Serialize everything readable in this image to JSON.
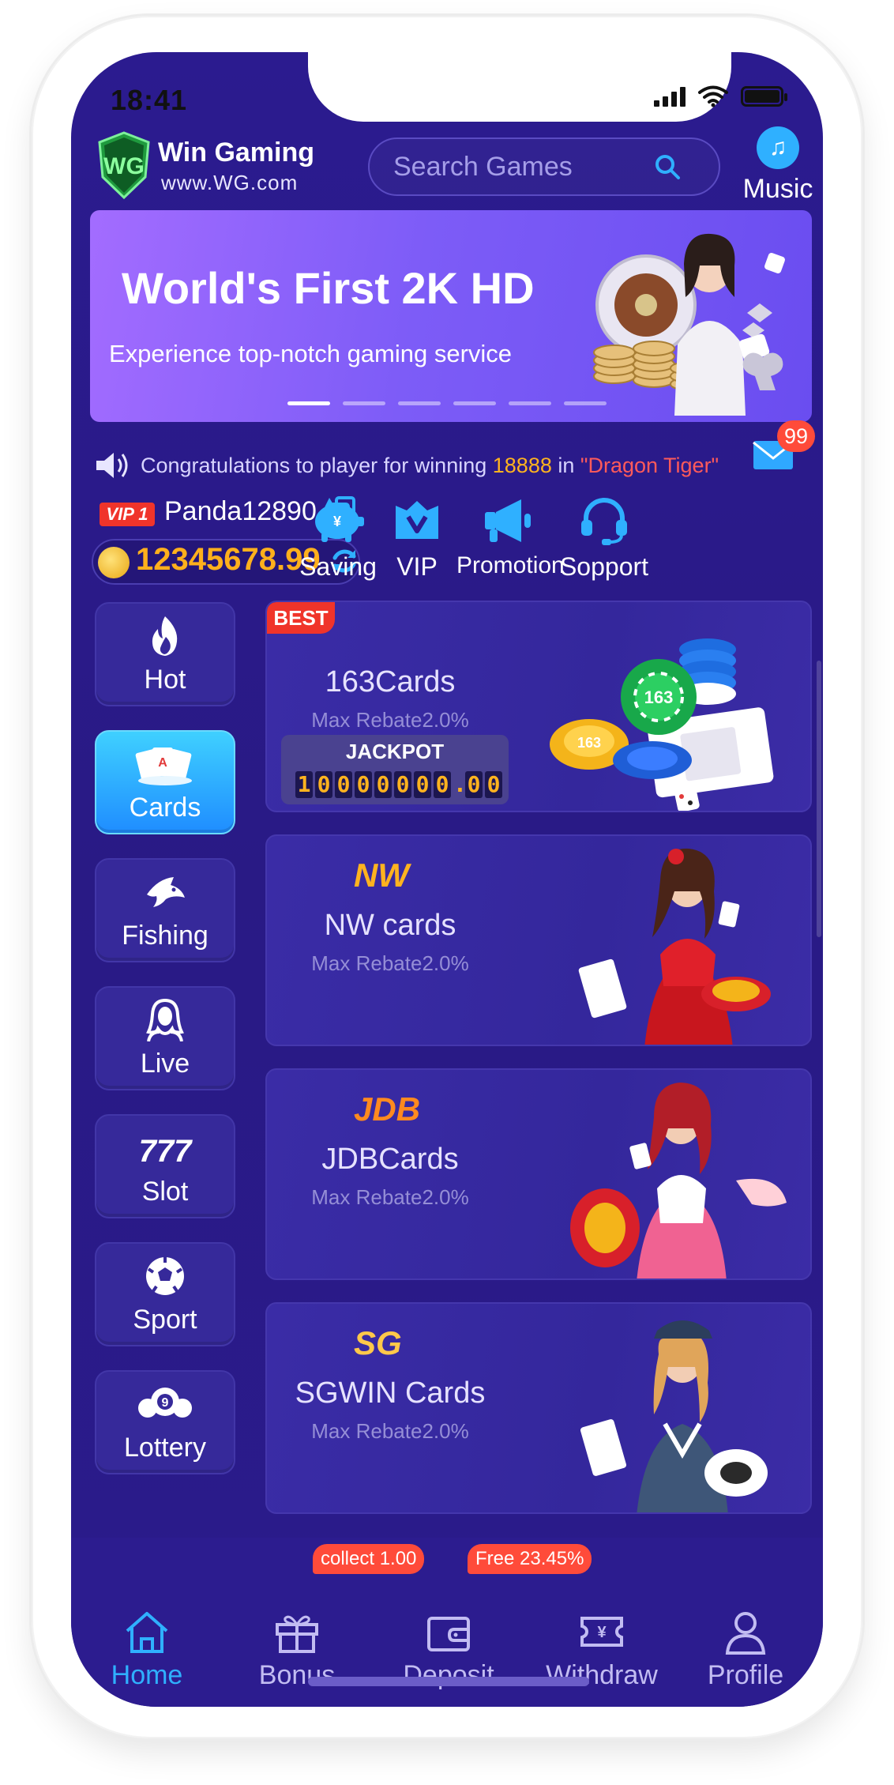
{
  "status_bar": {
    "time": "18:41"
  },
  "header": {
    "brand_name": "Win Gaming",
    "brand_url": "www.WG.com",
    "search_placeholder": "Search Games",
    "music_label": "Music"
  },
  "banner": {
    "title": "World's First 2K HD",
    "subtitle": "Experience top-notch gaming service",
    "slide_count": 6,
    "active_slide": 1
  },
  "marquee": {
    "prefix": "Congratulations to player for winning ",
    "amount": "18888",
    "middle": " in ",
    "game": "\"Dragon Tiger\"",
    "mail_badge": "99"
  },
  "user": {
    "vip_level": "VIP 1",
    "username": "Panda12890",
    "balance": "12345678.99"
  },
  "quick_actions": [
    {
      "label": "Saving",
      "icon": "piggy-bank-icon"
    },
    {
      "label": "VIP",
      "icon": "vip-icon"
    },
    {
      "label": "Promotion",
      "icon": "megaphone-icon"
    },
    {
      "label": "Sopport",
      "icon": "headset-icon"
    }
  ],
  "categories": [
    {
      "label": "Hot",
      "icon": "flame-icon"
    },
    {
      "label": "Cards",
      "icon": "cards-icon",
      "active": true
    },
    {
      "label": "Fishing",
      "icon": "shark-icon"
    },
    {
      "label": "Live",
      "icon": "dealer-icon"
    },
    {
      "label": "Slot",
      "icon": "777-icon"
    },
    {
      "label": "Sport",
      "icon": "soccer-ball-icon"
    },
    {
      "label": "Lottery",
      "icon": "lottery-ball-icon"
    }
  ],
  "games": [
    {
      "name": "163Cards",
      "rebate": "Max Rebate2.0%",
      "tag": "BEST",
      "jackpot_label": "JACKPOT",
      "jackpot_value": "10000000.00"
    },
    {
      "name": "NW cards",
      "rebate": "Max Rebate2.0%",
      "logo": "NW"
    },
    {
      "name": "JDBCards",
      "rebate": "Max Rebate2.0%",
      "logo": "JDB"
    },
    {
      "name": "SGWIN Cards",
      "rebate": "Max Rebate2.0%",
      "logo": "SG"
    }
  ],
  "bottom_nav": [
    {
      "label": "Home",
      "icon": "home-icon",
      "active": true
    },
    {
      "label": "Bonus",
      "icon": "gift-icon",
      "badge": "collect 1.00"
    },
    {
      "label": "Deposit",
      "icon": "wallet-icon",
      "badge": "Free 23.45%"
    },
    {
      "label": "Withdraw",
      "icon": "ticket-yen-icon"
    },
    {
      "label": "Profile",
      "icon": "person-icon"
    }
  ],
  "colors": {
    "background": "#2b1b8f",
    "accent": "#2fb0ff",
    "gold": "#ffb01c",
    "alert": "#f0342a"
  }
}
